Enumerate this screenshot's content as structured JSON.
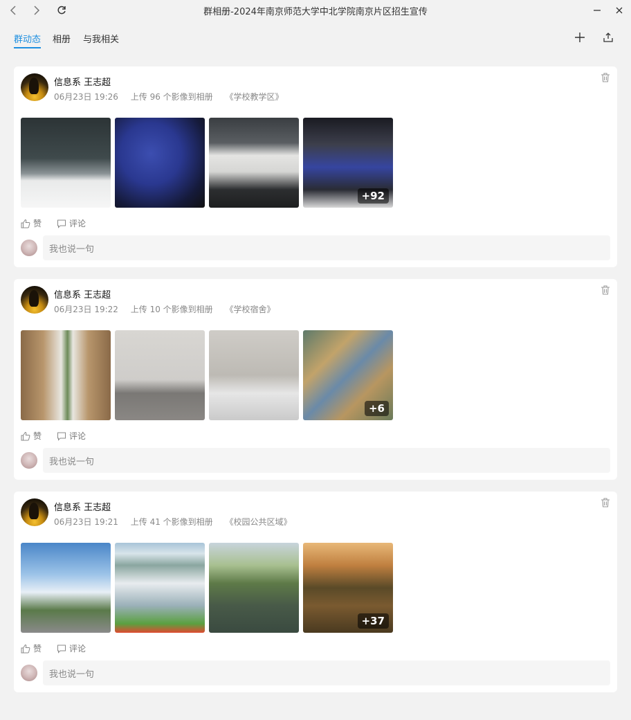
{
  "window": {
    "title": "群相册-2024年南京师范大学中北学院南京片区招生宣传"
  },
  "tabs": [
    {
      "label": "群动态",
      "active": true
    },
    {
      "label": "相册",
      "active": false
    },
    {
      "label": "与我相关",
      "active": false
    }
  ],
  "accent_color": "#1e8fe0",
  "posts": [
    {
      "author": "信息系 王志超",
      "date": "06月23日 19:26",
      "upload_text": "上传 96 个影像到相册",
      "album": "《学校教学区》",
      "more_count": "+92",
      "like_label": "赞",
      "comment_label": "评论",
      "comment_placeholder": "我也说一句"
    },
    {
      "author": "信息系 王志超",
      "date": "06月23日 19:22",
      "upload_text": "上传 10 个影像到相册",
      "album": "《学校宿舍》",
      "more_count": "+6",
      "like_label": "赞",
      "comment_label": "评论",
      "comment_placeholder": "我也说一句"
    },
    {
      "author": "信息系 王志超",
      "date": "06月23日 19:21",
      "upload_text": "上传 41 个影像到相册",
      "album": "《校园公共区域》",
      "more_count": "+37",
      "like_label": "赞",
      "comment_label": "评论",
      "comment_placeholder": "我也说一句"
    }
  ]
}
